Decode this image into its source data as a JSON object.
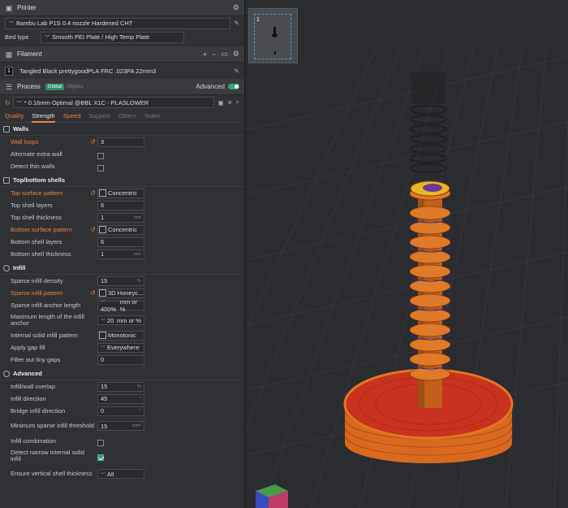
{
  "printer": {
    "title": "Printer",
    "name": "Bambu Lab P1S 0.4 nozzle Hardened CHT",
    "bed_type_label": "Bed type",
    "bed_type": "Smooth PEI Plate / High Temp Plate"
  },
  "filament": {
    "title": "Filament",
    "slot": "1",
    "name": "Tangled Black prettygoodPLA FRC .023PA 22mm3"
  },
  "process": {
    "title": "Process",
    "badge_global": "Global",
    "badge_objects": "Objects",
    "advanced_label": "Advanced",
    "preset": "* 0.16mm Optimal @BBL X1C - PLASLOWER",
    "tabs": [
      "Quality",
      "Strength",
      "Speed",
      "Support",
      "Others",
      "Notes"
    ]
  },
  "walls": {
    "title": "Walls",
    "wall_loops_label": "Wall loops",
    "wall_loops": "3",
    "alternate_label": "Alternate extra wall",
    "detect_thin_label": "Detect thin walls"
  },
  "topbottom": {
    "title": "Top/bottom shells",
    "top_pattern_label": "Top surface pattern",
    "top_pattern": "Concentric",
    "top_layers_label": "Top shell layers",
    "top_layers": "6",
    "top_thickness_label": "Top shell thickness",
    "top_thickness": "1",
    "top_thickness_unit": "mm",
    "bottom_pattern_label": "Bottom surface pattern",
    "bottom_pattern": "Concentric",
    "bottom_layers_label": "Bottom shell layers",
    "bottom_layers": "6",
    "bottom_thickness_label": "Bottom shell thickness",
    "bottom_thickness": "1",
    "bottom_thickness_unit": "mm"
  },
  "infill": {
    "title": "Infill",
    "density_label": "Sparse infill density",
    "density": "15",
    "density_unit": "%",
    "pattern_label": "Sparse infill pattern",
    "pattern": "3D Honeyc...",
    "anchor_label": "Sparse infill anchor length",
    "anchor": "400%",
    "anchor_unit": "mm or %",
    "max_anchor_label": "Maximum length of the infill anchor",
    "max_anchor": "20",
    "max_anchor_unit": "mm or %",
    "solid_pattern_label": "Internal solid infill pattern",
    "solid_pattern": "Monotonic",
    "gap_fill_label": "Apply gap fill",
    "gap_fill": "Everywhere",
    "filter_gaps_label": "Filter out tiny gaps",
    "filter_gaps": "0"
  },
  "advanced": {
    "title": "Advanced",
    "overlap_label": "Infill/wall overlap",
    "overlap": "15",
    "overlap_unit": "%",
    "direction_label": "Infill direction",
    "direction": "45",
    "direction_unit": "°",
    "bridge_dir_label": "Bridge infill direction",
    "bridge_dir": "0",
    "bridge_dir_unit": "°",
    "min_sparse_label": "Minimum sparse infill threshold",
    "min_sparse": "15",
    "min_sparse_unit": "mm²",
    "combination_label": "Infill combination",
    "narrow_label": "Detect narrow internal solid infill",
    "vertical_label": "Ensure vertical shell thickness",
    "vertical": "All"
  },
  "plate": {
    "number": "1"
  },
  "colors": {
    "accent": "#f08040",
    "green": "#3aa57a",
    "print_orange": "#d9691f",
    "bed_red": "#c8321e"
  }
}
